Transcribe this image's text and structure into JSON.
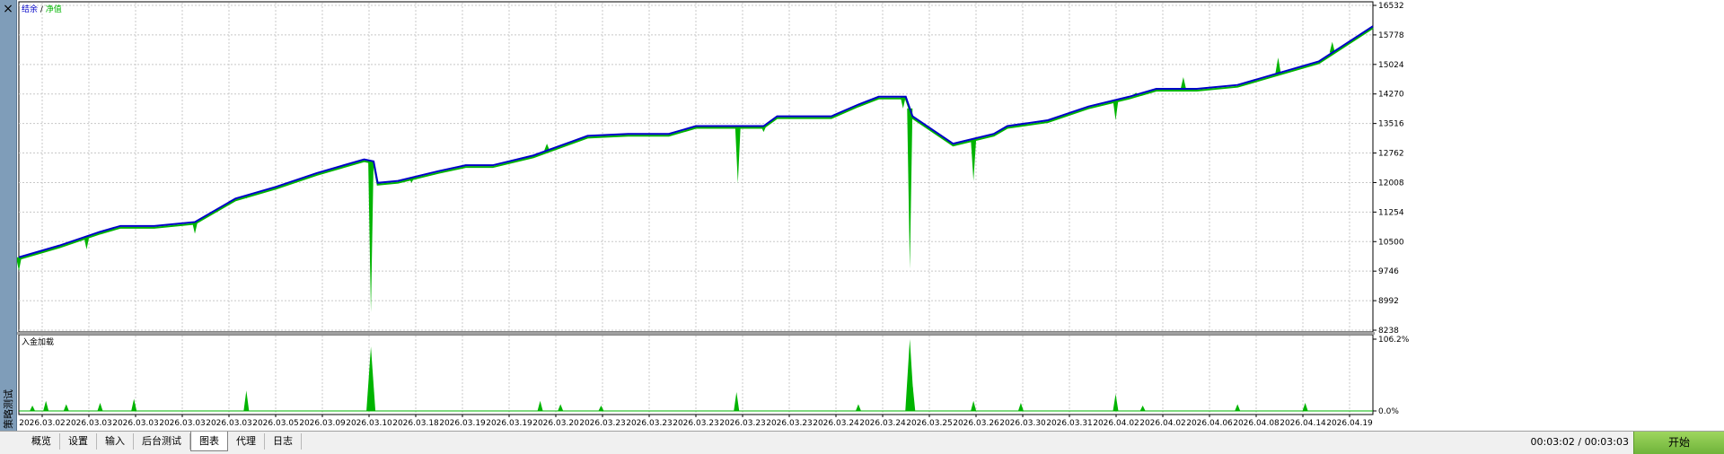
{
  "window": {
    "side_title": "策略测试",
    "close_label": "×"
  },
  "chart_data": [
    {
      "type": "line",
      "legend": [
        "结余",
        "净值"
      ],
      "legend_separator": "/",
      "series_colors": {
        "balance": "#0000c8",
        "equity": "#00b400"
      },
      "y_ticks": [
        16532,
        15778,
        15024,
        14270,
        13516,
        12762,
        12008,
        11254,
        10500,
        9746,
        8992,
        8238
      ],
      "ylim": [
        8238,
        16532
      ],
      "x_tick_labels": [
        "2026.03.02",
        "2026.03.03",
        "2026.03.03",
        "2026.03.03",
        "2026.03.03",
        "2026.03.05",
        "2026.03.09",
        "2026.03.10",
        "2026.03.18",
        "2026.03.19",
        "2026.03.19",
        "2026.03.20",
        "2026.03.23",
        "2026.03.23",
        "2026.03.23",
        "2026.03.23",
        "2026.03.23",
        "2026.03.24",
        "2026.03.24",
        "2026.03.25",
        "2026.03.26",
        "2026.03.30",
        "2026.03.31",
        "2026.04.02",
        "2026.04.02",
        "2026.04.06",
        "2026.04.08",
        "2026.04.14",
        "2026.04.19"
      ],
      "balance_x": [
        0,
        0.03,
        0.06,
        0.075,
        0.1,
        0.13,
        0.16,
        0.19,
        0.22,
        0.255,
        0.262,
        0.265,
        0.28,
        0.31,
        0.33,
        0.35,
        0.38,
        0.4,
        0.42,
        0.45,
        0.48,
        0.5,
        0.53,
        0.55,
        0.56,
        0.6,
        0.62,
        0.635,
        0.655,
        0.66,
        0.69,
        0.72,
        0.73,
        0.76,
        0.79,
        0.82,
        0.84,
        0.87,
        0.9,
        0.93,
        0.96,
        1.0
      ],
      "balance": [
        10100,
        10400,
        10750,
        10900,
        10900,
        11000,
        11600,
        11900,
        12250,
        12600,
        12550,
        12000,
        12050,
        12300,
        12450,
        12450,
        12700,
        12950,
        13200,
        13250,
        13250,
        13450,
        13450,
        13450,
        13700,
        13700,
        14000,
        14200,
        14200,
        13700,
        13000,
        13250,
        13450,
        13600,
        13950,
        14200,
        14400,
        14400,
        14500,
        14800,
        15100,
        16000
      ],
      "drawdown_spikes": [
        [
          0.0,
          9750
        ],
        [
          0.05,
          10300
        ],
        [
          0.13,
          10700
        ],
        [
          0.168,
          11600
        ],
        [
          0.26,
          8700
        ],
        [
          0.29,
          12000
        ],
        [
          0.39,
          13000
        ],
        [
          0.531,
          11990
        ],
        [
          0.55,
          13300
        ],
        [
          0.653,
          13900
        ],
        [
          0.658,
          9800
        ],
        [
          0.705,
          12050
        ],
        [
          0.81,
          13600
        ],
        [
          0.825,
          14300
        ],
        [
          0.86,
          14700
        ],
        [
          0.93,
          15200
        ],
        [
          0.97,
          15600
        ]
      ],
      "xlim": [
        0,
        1
      ]
    },
    {
      "type": "area",
      "legend": [
        "入金加载"
      ],
      "series_color": "#00b400",
      "y_ticks": [
        "106.2%",
        "0.0%"
      ],
      "ylim": [
        0,
        106.2
      ],
      "spikes": [
        [
          0.01,
          8
        ],
        [
          0.02,
          15
        ],
        [
          0.035,
          10
        ],
        [
          0.06,
          12
        ],
        [
          0.085,
          18
        ],
        [
          0.168,
          30
        ],
        [
          0.26,
          95
        ],
        [
          0.385,
          15
        ],
        [
          0.4,
          10
        ],
        [
          0.43,
          8
        ],
        [
          0.53,
          28
        ],
        [
          0.62,
          10
        ],
        [
          0.658,
          106.2
        ],
        [
          0.66,
          40
        ],
        [
          0.705,
          15
        ],
        [
          0.74,
          12
        ],
        [
          0.81,
          25
        ],
        [
          0.83,
          8
        ],
        [
          0.9,
          10
        ],
        [
          0.95,
          12
        ]
      ]
    }
  ],
  "bottom_bar": {
    "tabs": [
      {
        "label": "概览",
        "active": false
      },
      {
        "label": "设置",
        "active": false
      },
      {
        "label": "输入",
        "active": false
      },
      {
        "label": "后台测试",
        "active": false
      },
      {
        "label": "图表",
        "active": true
      },
      {
        "label": "代理",
        "active": false
      },
      {
        "label": "日志",
        "active": false
      }
    ],
    "timer": "00:03:02 / 00:03:03",
    "start_label": "开始"
  }
}
